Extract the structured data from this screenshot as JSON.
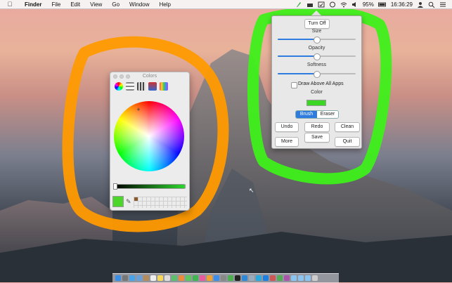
{
  "menubar": {
    "apple": "",
    "app_name": "Finder",
    "items": [
      "File",
      "Edit",
      "View",
      "Go",
      "Window",
      "Help"
    ],
    "battery": "95%",
    "clock": "16:36:29"
  },
  "colors_panel": {
    "title": "Colors",
    "tab_icons": [
      "color-wheel-icon",
      "color-sliders-icon",
      "color-palettes-icon",
      "image-palettes-icon",
      "crayons-icon"
    ],
    "selected_color": "#4cd62b"
  },
  "paint_panel": {
    "turn_off": "Turn Off",
    "size_label": "Size",
    "size_value": 0.5,
    "opacity_label": "Opacity",
    "opacity_value": 0.5,
    "softness_label": "Softness",
    "softness_value": 0.5,
    "draw_above": "Draw Above All Apps",
    "color_label": "Color",
    "color_value": "#3cd624",
    "brush": "Brush",
    "eraser": "Eraser",
    "undo": "Undo",
    "redo": "Redo",
    "clean": "Clean",
    "save": "Save",
    "more": "More",
    "quit": "Quit"
  },
  "annotations": {
    "orange_stroke_color": "#ff9a00",
    "green_stroke_color": "#3ef01a"
  }
}
